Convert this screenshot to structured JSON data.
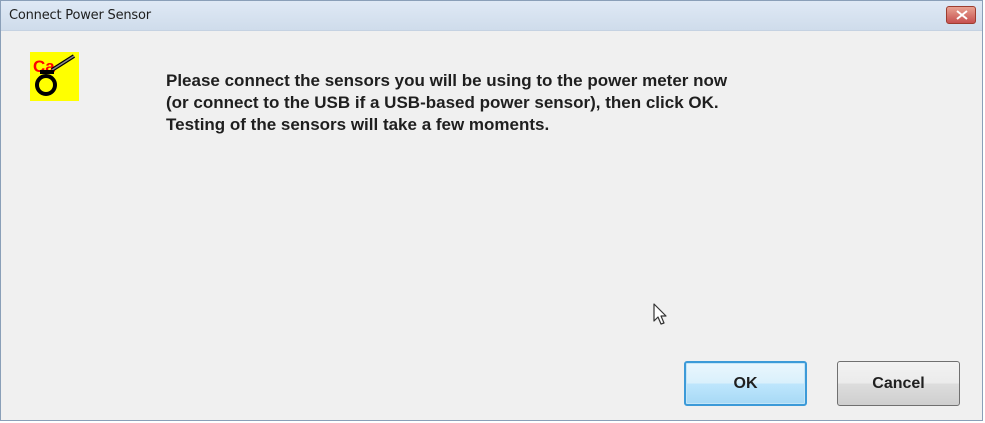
{
  "window": {
    "title": "Connect Power Sensor"
  },
  "dialog": {
    "icon": "cal-tool-icon",
    "message": "Please connect the sensors you will be using to the power meter now\n(or connect to the USB if a USB-based power sensor), then click OK.\n Testing of the sensors will take a few moments."
  },
  "buttons": {
    "ok_label": "OK",
    "cancel_label": "Cancel"
  },
  "colors": {
    "dialog_background": "#f0f0f0",
    "titlebar": "#dfe9f5",
    "close_button": "#c75050",
    "icon_background": "#ffff00",
    "icon_text": "#ff0000",
    "ok_border": "#3c9ad8"
  }
}
